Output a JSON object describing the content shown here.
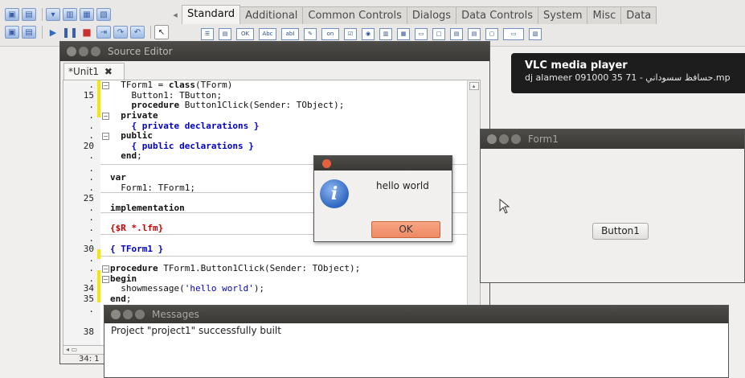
{
  "toolbar": {
    "tabs": [
      "Standard",
      "Additional",
      "Common Controls",
      "Dialogs",
      "Data Controls",
      "System",
      "Misc",
      "Data"
    ],
    "active_tab": "Standard",
    "palette_labels": {
      "button": "OK",
      "label": "Abc",
      "edit": "abI",
      "toggle": "on"
    }
  },
  "vlc": {
    "title": "VLC media player",
    "subtitle": "dj alameer 091000 35 71 - حسافظ سسوداني.mp"
  },
  "editor": {
    "title": "Source Editor",
    "tab_label": "*Unit1",
    "status": "34: 1",
    "lines": [
      {
        "ln": ".",
        "html": "<span class='line-text'>  TForm1 = <span class='kw'>class</span>(TForm)</span>"
      },
      {
        "ln": "15",
        "html": "    Button1: TButton;"
      },
      {
        "ln": ".",
        "html": "    <span class='kw'>procedure</span> Button1Click(Sender: TObject);"
      },
      {
        "ln": ".",
        "html": "  <span class='kw'>private</span>"
      },
      {
        "ln": ".",
        "html": "    <span class='cm'>{ private declarations }</span>"
      },
      {
        "ln": ".",
        "html": "  <span class='kw'>public</span>"
      },
      {
        "ln": "20",
        "html": "    <span class='cm'>{ public declarations }</span>"
      },
      {
        "ln": ".",
        "html": "  <span class='kw'>end</span>;"
      },
      {
        "ln": ".",
        "html": ""
      },
      {
        "ln": ".",
        "html": "<span class='kw'>var</span>"
      },
      {
        "ln": ".",
        "html": "  Form1: TForm1;"
      },
      {
        "ln": "25",
        "html": ""
      },
      {
        "ln": ".",
        "html": "<span class='kw'>implementation</span>"
      },
      {
        "ln": ".",
        "html": ""
      },
      {
        "ln": ".",
        "html": "<span class='dr'>{$R *.lfm}</span>"
      },
      {
        "ln": ".",
        "html": ""
      },
      {
        "ln": "30",
        "html": "<span class='cm'>{ TForm1 }</span>"
      },
      {
        "ln": ".",
        "html": ""
      },
      {
        "ln": ".",
        "html": "<span class='kw'>procedure</span> TForm1.Button1Click(Sender: TObject);"
      },
      {
        "ln": ".",
        "html": "<span class='kw'>begin</span>"
      },
      {
        "ln": "34",
        "html": "  showmessage(<span class='st'>'hello world'</span>);"
      },
      {
        "ln": "35",
        "html": "<span class='kw'>end</span>;"
      },
      {
        "ln": ".",
        "html": ""
      },
      {
        "ln": "38",
        "html": ""
      }
    ]
  },
  "form1": {
    "title": "Form1",
    "button_label": "Button1"
  },
  "dialog": {
    "message": "hello world",
    "ok_label": "OK"
  },
  "messages": {
    "title": "Messages",
    "text": "Project \"project1\" successfully built"
  }
}
